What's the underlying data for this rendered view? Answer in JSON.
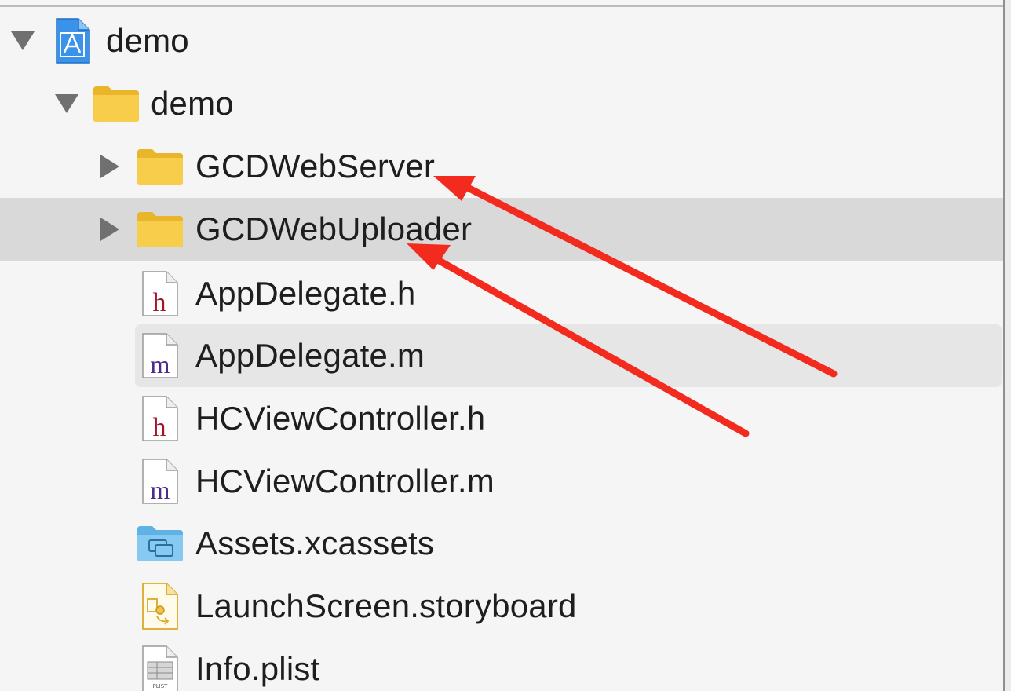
{
  "navigator": {
    "items": [
      {
        "label": "demo",
        "icon": "xcode-project-icon",
        "disclosure": "expanded"
      },
      {
        "label": "demo",
        "icon": "folder-icon",
        "disclosure": "expanded"
      },
      {
        "label": "GCDWebServer",
        "icon": "folder-icon",
        "disclosure": "collapsed"
      },
      {
        "label": "GCDWebUploader",
        "icon": "folder-icon",
        "disclosure": "collapsed"
      },
      {
        "label": "AppDelegate.h",
        "icon": "header-file-icon",
        "icon_glyph": "h"
      },
      {
        "label": "AppDelegate.m",
        "icon": "implementation-file-icon",
        "icon_glyph": "m"
      },
      {
        "label": "HCViewController.h",
        "icon": "header-file-icon",
        "icon_glyph": "h"
      },
      {
        "label": "HCViewController.m",
        "icon": "implementation-file-icon",
        "icon_glyph": "m"
      },
      {
        "label": "Assets.xcassets",
        "icon": "asset-catalog-icon"
      },
      {
        "label": "LaunchScreen.storyboard",
        "icon": "storyboard-icon"
      },
      {
        "label": "Info.plist",
        "icon": "plist-file-icon",
        "icon_glyph": "PLIST"
      }
    ]
  },
  "annotations": {
    "arrow_color": "#f22b1e",
    "arrow_targets": [
      "GCDWebServer",
      "GCDWebUploader"
    ]
  },
  "colors": {
    "folder": "#f6c543",
    "header_glyph": "#a3132a",
    "impl_glyph": "#4a2a8a",
    "project_blue": "#2f8ae5",
    "asset_blue": "#7cc4ef",
    "selection_group": "#d9d9d9",
    "selection_file": "#e6e6e6"
  }
}
